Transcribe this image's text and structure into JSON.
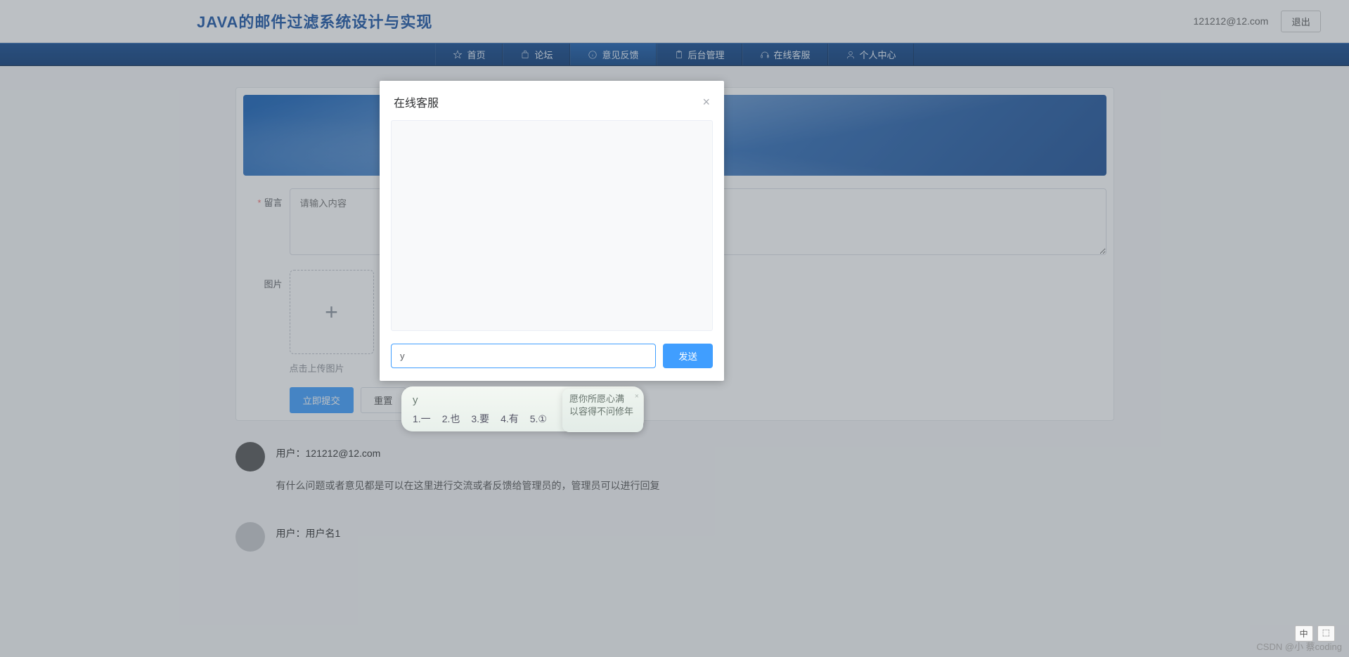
{
  "header": {
    "app_title": "JAVA的邮件过滤系统设计与实现",
    "user_email": "121212@12.com",
    "logout_label": "退出"
  },
  "nav": {
    "items": [
      {
        "label": "首页"
      },
      {
        "label": "论坛"
      },
      {
        "label": "意见反馈"
      },
      {
        "label": "后台管理"
      },
      {
        "label": "在线客服"
      },
      {
        "label": "个人中心"
      }
    ],
    "active_index": 2
  },
  "feedback_form": {
    "message_label": "留言",
    "message_placeholder": "请输入内容",
    "message_value": "",
    "image_label": "图片",
    "upload_hint": "点击上传图片",
    "submit_label": "立即提交",
    "reset_label": "重置"
  },
  "comments": [
    {
      "user_prefix": "用户：",
      "user": "121212@12.com",
      "text": "有什么问题或者意见都是可以在这里进行交流或者反馈给管理员的，管理员可以进行回复"
    },
    {
      "user_prefix": "用户：",
      "user": "用户名1",
      "text": ""
    }
  ],
  "chat_modal": {
    "title": "在线客服",
    "input_value": "y",
    "send_label": "发送"
  },
  "ime": {
    "typing": "y",
    "candidates": [
      "1.一",
      "2.也",
      "3.要",
      "4.有",
      "5.①"
    ],
    "extra_line1": "愿你所愿心满",
    "extra_line2": "以容得不问修年"
  },
  "footer": {
    "lang_indicator": "中",
    "watermark": "CSDN @小 蔡coding"
  }
}
